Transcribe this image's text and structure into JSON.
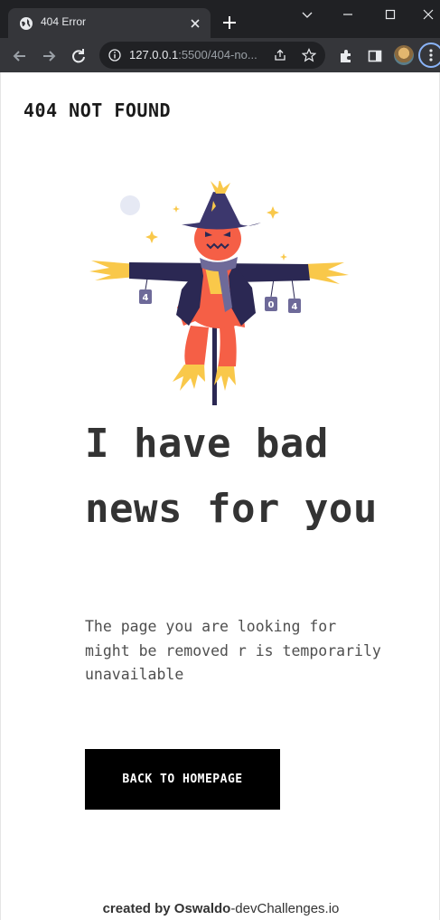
{
  "browser": {
    "tab": {
      "title": "404 Error"
    },
    "address_bar": {
      "host": "127.0.0.1",
      "rest": ":5500/404-no..."
    }
  },
  "page": {
    "brand": "404 NOT FOUND",
    "illustration": {
      "sign_left": "4",
      "sign_mid": "0",
      "sign_right": "4"
    },
    "headline": "I have bad news for you",
    "description": "The page you are looking for might be removed r is temporarily unavailable",
    "button_label": "BACK TO HOMEPAGE",
    "footer": {
      "credit": "created by Oswaldo",
      "site": "-devChallenges.io"
    }
  },
  "colors": {
    "chrome_dark": "#202124",
    "chrome_toolbar": "#35363a",
    "text_dark": "#333333",
    "button_bg": "#000000",
    "scarecrow_coat": "#2b2853",
    "scarecrow_head": "#f55f46",
    "straw": "#f9c84a",
    "hat": "#3c376d"
  }
}
